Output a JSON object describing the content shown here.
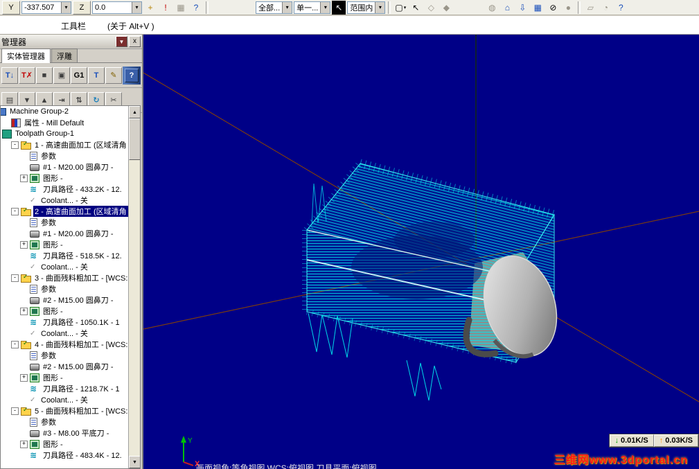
{
  "top_toolbar": {
    "items": [
      {
        "t": "btn",
        "label": "Y",
        "name": "y-axis-button"
      },
      {
        "t": "field",
        "value": "-337.507",
        "name": "y-coordinate-field"
      },
      {
        "t": "btn",
        "label": "Z",
        "name": "z-axis-button"
      },
      {
        "t": "field",
        "value": "0.0",
        "name": "z-coordinate-field"
      },
      {
        "t": "icon",
        "glyph": "+",
        "name": "fast-point-icon",
        "color": "#b8860b"
      },
      {
        "t": "icon",
        "glyph": "!",
        "name": "construction-mode-icon",
        "color": "#c00000"
      },
      {
        "t": "icon",
        "glyph": "▦",
        "name": "grid-icon",
        "dis": true
      },
      {
        "t": "icon",
        "glyph": "?",
        "name": "help-icon",
        "color": "#1a4fba"
      },
      {
        "t": "sep"
      },
      {
        "t": "gap",
        "w": 62
      },
      {
        "t": "combo",
        "label": "全部...",
        "name": "select-all-combo"
      },
      {
        "t": "combo",
        "label": "单一...",
        "name": "select-single-combo"
      },
      {
        "t": "icon",
        "glyph": "↖",
        "name": "selection-cursor-icon",
        "dark": true
      },
      {
        "t": "combo",
        "label": "范围内",
        "name": "select-range-combo"
      },
      {
        "t": "sep"
      },
      {
        "t": "icon",
        "glyph": "▢",
        "name": "window-select-icon",
        "dd": true
      },
      {
        "t": "icon",
        "glyph": "↖",
        "name": "pointer-select-icon"
      },
      {
        "t": "icon",
        "glyph": "◇",
        "name": "polygon-select-icon",
        "dis": true
      },
      {
        "t": "icon",
        "glyph": "◆",
        "name": "solid-select-icon",
        "dis": true
      },
      {
        "t": "gap",
        "w": 42
      },
      {
        "t": "icon",
        "glyph": "◍",
        "name": "shading-icon",
        "dis": true
      },
      {
        "t": "icon",
        "glyph": "⌂",
        "name": "gview-home-icon",
        "color": "#1a4fba"
      },
      {
        "t": "icon",
        "glyph": "⇩",
        "name": "zoom-target-icon",
        "color": "#1a4fba"
      },
      {
        "t": "icon",
        "glyph": "▦",
        "name": "gview-grid-icon",
        "color": "#1a4fba"
      },
      {
        "t": "icon",
        "glyph": "⊘",
        "name": "hide-entities-icon"
      },
      {
        "t": "icon",
        "glyph": "●",
        "name": "blank-entity-icon",
        "dis": true
      },
      {
        "t": "sep"
      },
      {
        "t": "icon",
        "glyph": "▱",
        "name": "planes-icon",
        "dis": true
      },
      {
        "t": "icon",
        "glyph": "◔",
        "name": "rotate-view-icon",
        "dis": true
      },
      {
        "t": "icon",
        "glyph": "?",
        "name": "help-2-icon",
        "color": "#1a4fba"
      }
    ]
  },
  "tooltip_row": {
    "title": "工具栏",
    "hint": "(关于 Alt+V )"
  },
  "manager_panel": {
    "title": "管理器",
    "dropdown_glyph": "▼",
    "close_glyph": "x",
    "tabs": [
      {
        "label": "实体管理器"
      },
      {
        "label": "浮雕"
      }
    ],
    "toolbar1": [
      {
        "glyph": "T↓",
        "name": "select-all-operations-icon",
        "color": "#1a4fba"
      },
      {
        "glyph": "T✗",
        "name": "deselect-operations-icon",
        "color": "#c00000"
      },
      {
        "glyph": "■",
        "name": "regenerate-all-icon",
        "color": "#404040"
      },
      {
        "glyph": "▣",
        "name": "regenerate-selected-icon",
        "color": "#404040"
      },
      {
        "glyph": "G1",
        "name": "post-selected-icon",
        "color": "#000000"
      },
      {
        "glyph": "T",
        "name": "toolpath-config-icon",
        "color": "#1a4fba"
      },
      {
        "glyph": "✎",
        "name": "edit-operation-icon",
        "color": "#806000"
      }
    ],
    "toolbar1_help": "?",
    "toolbar2": [
      {
        "glyph": "▤",
        "name": "insert-position-icon",
        "color": "#404040"
      },
      {
        "glyph": "▼",
        "name": "move-insert-down-icon",
        "color": "#404040"
      },
      {
        "glyph": "▲",
        "name": "move-insert-up-icon",
        "color": "#404040"
      },
      {
        "glyph": "⇥",
        "name": "move-insert-end-icon",
        "color": "#404040"
      },
      {
        "glyph": "⇅",
        "name": "scroll-toggle-icon",
        "color": "#404040"
      },
      {
        "glyph": "↻",
        "name": "refresh-tree-icon",
        "color": "#1a7fba"
      },
      {
        "glyph": "✂",
        "name": "trim-icon",
        "color": "#404040"
      }
    ],
    "tree_items": [
      {
        "depth": 0,
        "icon": "machine",
        "label": "Machine Group-2",
        "clip": true
      },
      {
        "depth": 1,
        "icon": "properties",
        "label": "属性 - Mill Default"
      },
      {
        "depth": 0,
        "icon": "group",
        "label": "Toolpath Group-1"
      },
      {
        "depth": 1,
        "exp": "-",
        "icon": "folder",
        "label": "1 - 高速曲面加工 (区域清角"
      },
      {
        "depth": 2,
        "icon": "params",
        "label": "参数"
      },
      {
        "depth": 2,
        "icon": "tool",
        "label": "#1 - M20.00 圆鼻刀 -"
      },
      {
        "depth": 2,
        "exp": "+",
        "icon": "geometry",
        "label": "图形 -"
      },
      {
        "depth": 2,
        "icon": "path",
        "label": "刀具路径 - 433.2K - 12."
      },
      {
        "depth": 2,
        "icon": "coolant",
        "label": "Coolant... - 关"
      },
      {
        "depth": 1,
        "exp": "-",
        "icon": "folder",
        "label": "2 - 高速曲面加工 (区域清角",
        "selected": true
      },
      {
        "depth": 2,
        "icon": "params",
        "label": "参数"
      },
      {
        "depth": 2,
        "icon": "tool",
        "label": "#1 - M20.00 圆鼻刀 -"
      },
      {
        "depth": 2,
        "exp": "+",
        "icon": "geometry",
        "label": "图形 -"
      },
      {
        "depth": 2,
        "icon": "path",
        "label": "刀具路径 - 518.5K - 12."
      },
      {
        "depth": 2,
        "icon": "coolant",
        "label": "Coolant... - 关"
      },
      {
        "depth": 1,
        "exp": "-",
        "icon": "folder",
        "label": "3 - 曲面残料粗加工 - [WCS:"
      },
      {
        "depth": 2,
        "icon": "params",
        "label": "参数"
      },
      {
        "depth": 2,
        "icon": "tool",
        "label": "#2 - M15.00 圆鼻刀 -"
      },
      {
        "depth": 2,
        "exp": "+",
        "icon": "geometry",
        "label": "图形 -"
      },
      {
        "depth": 2,
        "icon": "path",
        "label": "刀具路径 - 1050.1K - 1"
      },
      {
        "depth": 2,
        "icon": "coolant",
        "label": "Coolant... - 关"
      },
      {
        "depth": 1,
        "exp": "-",
        "icon": "folder",
        "label": "4 - 曲面残料粗加工 - [WCS:"
      },
      {
        "depth": 2,
        "icon": "params",
        "label": "参数"
      },
      {
        "depth": 2,
        "icon": "tool",
        "label": "#2 - M15.00 圆鼻刀 -"
      },
      {
        "depth": 2,
        "exp": "+",
        "icon": "geometry",
        "label": "图形 -"
      },
      {
        "depth": 2,
        "icon": "path",
        "label": "刀具路径 - 1218.7K - 1"
      },
      {
        "depth": 2,
        "icon": "coolant",
        "label": "Coolant... - 关"
      },
      {
        "depth": 1,
        "exp": "-",
        "icon": "folder",
        "label": "5 - 曲面残料粗加工 - [WCS:"
      },
      {
        "depth": 2,
        "icon": "params",
        "label": "参数"
      },
      {
        "depth": 2,
        "icon": "tool",
        "label": "#3 - M8.00 平底刀 -"
      },
      {
        "depth": 2,
        "exp": "+",
        "icon": "geometry",
        "label": "图形 -"
      },
      {
        "depth": 2,
        "icon": "path",
        "label": "刀具路径 - 483.4K - 12."
      }
    ]
  },
  "viewport": {
    "status_text": "画面视角:等角视图 WCS:俯视图 刀具平面:俯视图",
    "speed_indicators": [
      {
        "arrow": "↓",
        "value": "0.01K/S",
        "color": "#00a000",
        "name": "down-speed-indicator"
      },
      {
        "arrow": "↑",
        "value": "0.03K/S",
        "color": "#ff9000",
        "name": "up-speed-indicator"
      }
    ],
    "watermark": "三维网www.3dportal.cn",
    "axis_gizmo": {
      "x": "X",
      "y": "Y"
    }
  }
}
